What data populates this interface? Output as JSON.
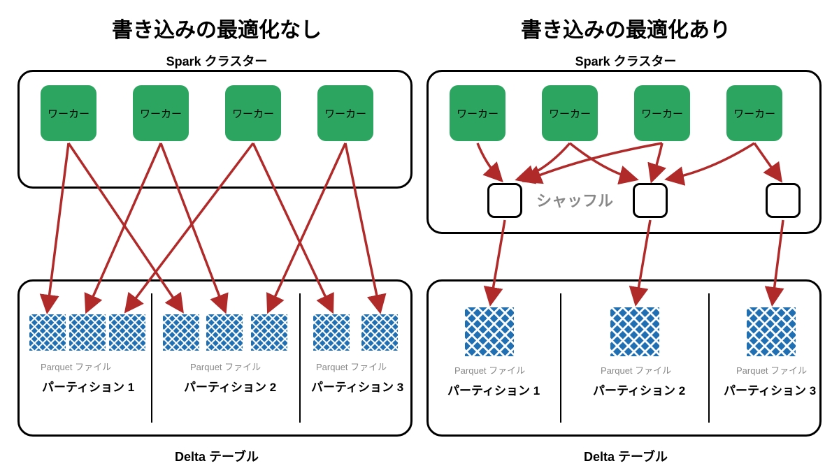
{
  "left": {
    "title": "書き込みの最適化なし",
    "cluster_label": "Spark クラスター",
    "worker_label": "ワーカー",
    "delta_label": "Delta テーブル",
    "parquet_file_label": "Parquet ファイル",
    "partitions": [
      "パーティション 1",
      "パーティション 2",
      "パーティション 3"
    ]
  },
  "right": {
    "title": "書き込みの最適化あり",
    "cluster_label": "Spark クラスター",
    "worker_label": "ワーカー",
    "shuffle_label": "シャッフル",
    "delta_label": "Delta テーブル",
    "parquet_file_label": "Parquet ファイル",
    "partitions": [
      "パーティション 1",
      "パーティション 2",
      "パーティション 3"
    ]
  },
  "colors": {
    "worker_bg": "#2ba55f",
    "arrow": "#b02a2a",
    "parquet": "#1f6fb2"
  }
}
